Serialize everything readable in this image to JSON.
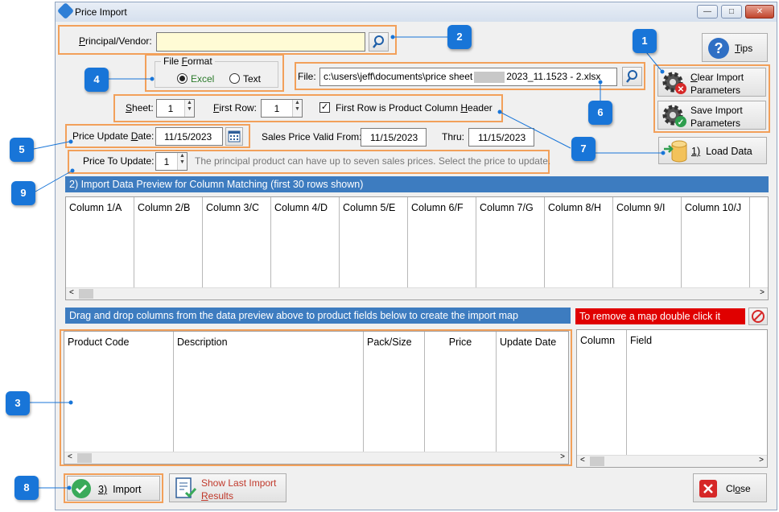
{
  "window": {
    "title": "Price Import",
    "minimize": "—",
    "maximize": "□",
    "close": "✕"
  },
  "principal": {
    "label": "Principal/Vendor:",
    "value": ""
  },
  "tips": {
    "label": "Tips"
  },
  "file_format": {
    "legend": "File Format",
    "excel": "Excel",
    "text": "Text",
    "selected": "excel"
  },
  "file": {
    "label": "File:",
    "path_left": "c:\\users\\jeff\\documents\\price sheet",
    "path_right": "2023_11.1523 - 2.xlsx"
  },
  "clear_params": {
    "line1": "Clear Import",
    "line2": "Parameters"
  },
  "save_params": {
    "line1": "Save Import",
    "line2": "Parameters"
  },
  "sheet": {
    "label": "Sheet:",
    "value": "1"
  },
  "first_row": {
    "label": "First Row:",
    "value": "1"
  },
  "header_check": {
    "label": "First Row is Product Column Header",
    "checked": true
  },
  "price_update_date": {
    "label": "Price Update Date:",
    "value": "11/15/2023"
  },
  "sales_valid_from": {
    "label": "Sales Price Valid From:",
    "value": "11/15/2023"
  },
  "thru": {
    "label": "Thru:",
    "value": "11/15/2023"
  },
  "load_data": {
    "prefix": "1)",
    "label": "Load Data"
  },
  "price_to_update": {
    "label": "Price To Update:",
    "value": "1",
    "hint": "The principal product can have up to seven sales prices.  Select the price to update."
  },
  "preview": {
    "title": "2) Import Data Preview for Column Matching (first 30 rows shown)",
    "columns": [
      "Column 1/A",
      "Column 2/B",
      "Column 3/C",
      "Column 4/D",
      "Column 5/E",
      "Column 6/F",
      "Column 7/G",
      "Column 8/H",
      "Column 9/I",
      "Column 10/J"
    ]
  },
  "map": {
    "title": "Drag and drop columns from the data preview above to product fields below to create the import map",
    "remove_hint": "To remove a map double click it",
    "fields": [
      "Product Code",
      "Description",
      "Pack/Size",
      "Price",
      "Update Date"
    ],
    "map_columns": [
      "Column",
      "Field"
    ]
  },
  "import_btn": {
    "prefix": "3)",
    "label": "Import"
  },
  "show_last": {
    "line1": "Show Last Import",
    "line2": "Results"
  },
  "close_btn": {
    "label": "Close"
  },
  "callouts": [
    "1",
    "2",
    "3",
    "4",
    "5",
    "6",
    "7",
    "8",
    "9"
  ],
  "colors": {
    "accent": "#1875d8",
    "highlight": "#f2a05a",
    "section": "#3d7cc0",
    "warning": "#e00000"
  }
}
